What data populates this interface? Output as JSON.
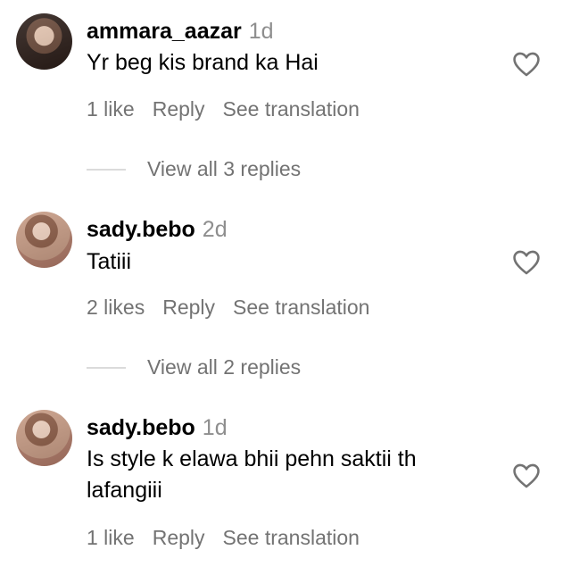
{
  "comments": [
    {
      "username": "ammara_aazar",
      "time": "1d",
      "text": "Yr beg kis brand ka Hai",
      "likes": "1 like",
      "reply": "Reply",
      "translate": "See translation",
      "replies": "View all 3 replies"
    },
    {
      "username": "sady.bebo",
      "time": "2d",
      "text": "Tatiii",
      "likes": "2 likes",
      "reply": "Reply",
      "translate": "See translation",
      "replies": "View all 2 replies"
    },
    {
      "username": "sady.bebo",
      "time": "1d",
      "text": "Is style k elawa bhii pehn saktii th lafangiii",
      "likes": "1 like",
      "reply": "Reply",
      "translate": "See translation"
    }
  ],
  "icons": {
    "avatar": "avatar",
    "like": "heart-icon"
  },
  "colors": {
    "secondary_text": "#737373",
    "timestamp": "#8e8e8e",
    "divider": "#dbdbdb"
  }
}
